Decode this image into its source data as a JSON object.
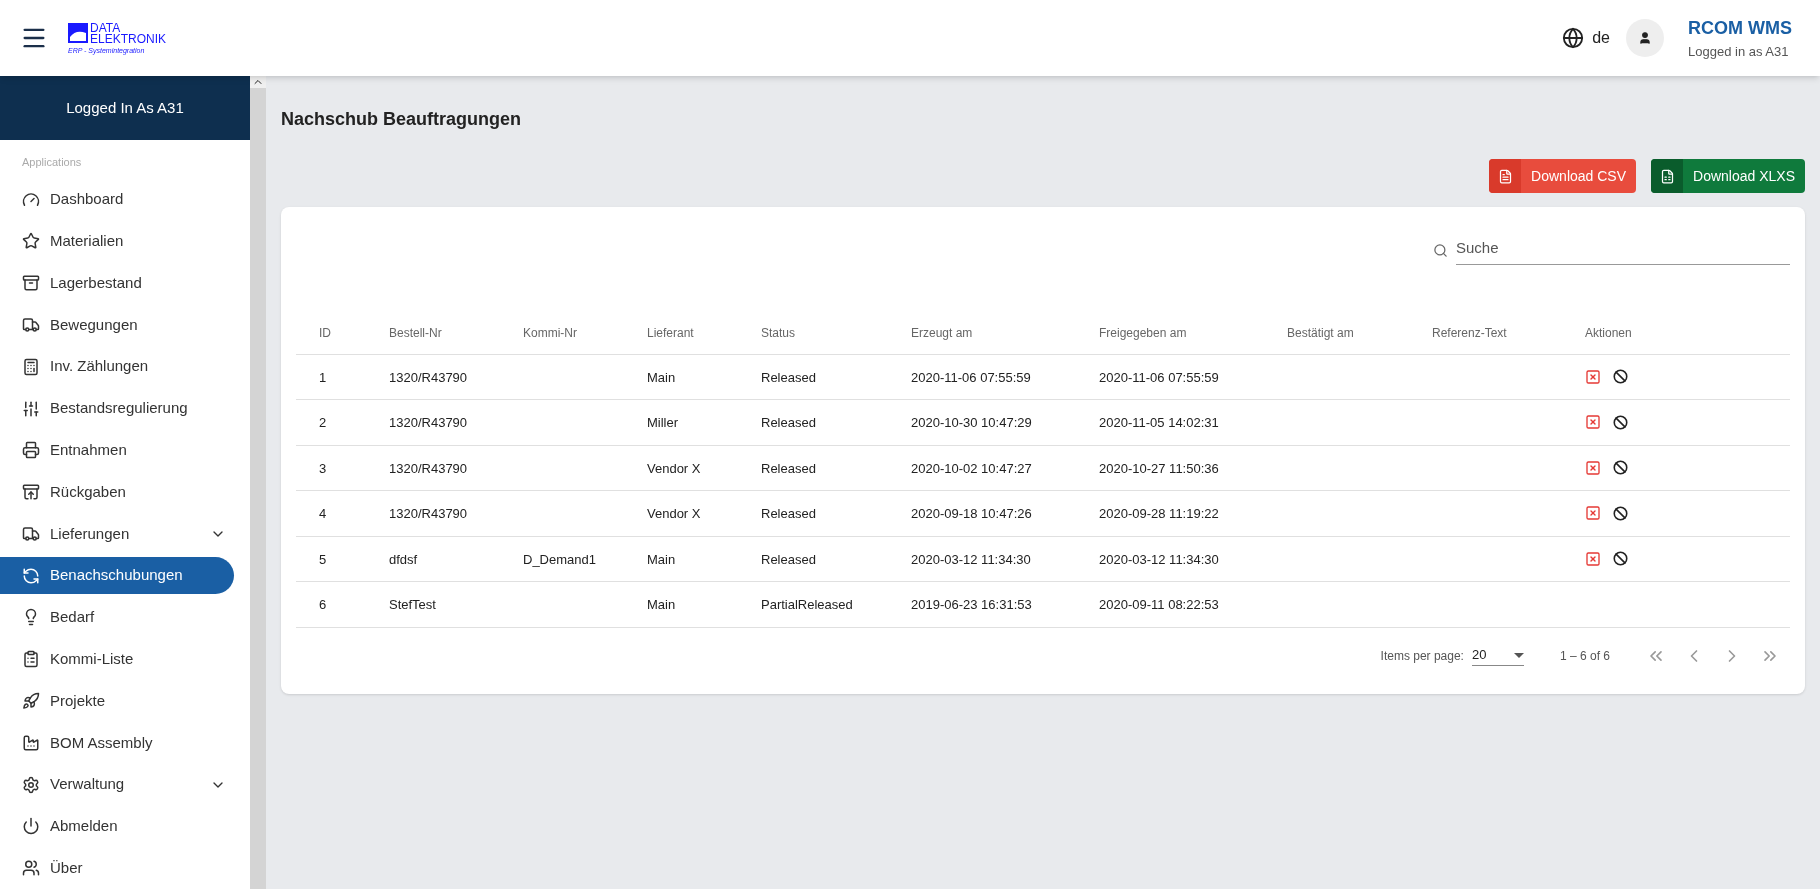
{
  "header": {
    "logo_line1": "DATA",
    "logo_line2": "ELEKTRONIK",
    "logo_tagline": "ERP - Systemintegration",
    "language": "de",
    "app_name": "RCOM WMS",
    "user_status": "Logged in as A31"
  },
  "sidebar": {
    "user_banner": "Logged In As A31",
    "section_label": "Applications",
    "items": [
      {
        "label": "Dashboard",
        "selected": false,
        "expandable": false
      },
      {
        "label": "Materialien",
        "selected": false,
        "expandable": false
      },
      {
        "label": "Lagerbestand",
        "selected": false,
        "expandable": false
      },
      {
        "label": "Bewegungen",
        "selected": false,
        "expandable": false
      },
      {
        "label": "Inv. Zählungen",
        "selected": false,
        "expandable": false
      },
      {
        "label": "Bestandsregulierung",
        "selected": false,
        "expandable": false
      },
      {
        "label": "Entnahmen",
        "selected": false,
        "expandable": false
      },
      {
        "label": "Rückgaben",
        "selected": false,
        "expandable": false
      },
      {
        "label": "Lieferungen",
        "selected": false,
        "expandable": true
      },
      {
        "label": "Benachschubungen",
        "selected": true,
        "expandable": false
      },
      {
        "label": "Bedarf",
        "selected": false,
        "expandable": false
      },
      {
        "label": "Kommi-Liste",
        "selected": false,
        "expandable": false
      },
      {
        "label": "Projekte",
        "selected": false,
        "expandable": false
      },
      {
        "label": "BOM Assembly",
        "selected": false,
        "expandable": false
      },
      {
        "label": "Verwaltung",
        "selected": false,
        "expandable": true
      },
      {
        "label": "Abmelden",
        "selected": false,
        "expandable": false
      },
      {
        "label": "Über",
        "selected": false,
        "expandable": false
      }
    ]
  },
  "page": {
    "title": "Nachschub Beauftragungen",
    "buttons": [
      {
        "kind": "csv",
        "label": "Download CSV"
      },
      {
        "kind": "xlsx",
        "label": "Download XLXS"
      }
    ],
    "search": {
      "placeholder": "Suche"
    },
    "table": {
      "columns": [
        "ID",
        "Bestell-Nr",
        "Kommi-Nr",
        "Lieferant",
        "Status",
        "Erzeugt am",
        "Freigegeben am",
        "Bestätigt am",
        "Referenz-Text",
        "Aktionen"
      ],
      "rows": [
        {
          "cells": [
            "1",
            "1320/R43790",
            "",
            "Main",
            "Released",
            "2020-11-06 07:55:59",
            "2020-11-06 07:55:59",
            "",
            ""
          ],
          "actions": true
        },
        {
          "cells": [
            "2",
            "1320/R43790",
            "",
            "Miller",
            "Released",
            "2020-10-30 10:47:29",
            "2020-11-05 14:02:31",
            "",
            ""
          ],
          "actions": true
        },
        {
          "cells": [
            "3",
            "1320/R43790",
            "",
            "Vendor X",
            "Released",
            "2020-10-02 10:47:27",
            "2020-10-27 11:50:36",
            "",
            ""
          ],
          "actions": true
        },
        {
          "cells": [
            "4",
            "1320/R43790",
            "",
            "Vendor X",
            "Released",
            "2020-09-18 10:47:26",
            "2020-09-28 11:19:22",
            "",
            ""
          ],
          "actions": true
        },
        {
          "cells": [
            "5",
            "dfdsf",
            "D_Demand1",
            "Main",
            "Released",
            "2020-03-12 11:34:30",
            "2020-03-12 11:34:30",
            "",
            ""
          ],
          "actions": true
        },
        {
          "cells": [
            "6",
            "StefTest",
            "",
            "Main",
            "PartialReleased",
            "2019-06-23 16:31:53",
            "2020-09-11 08:22:53",
            "",
            ""
          ],
          "actions": false
        }
      ]
    },
    "paginator": {
      "label": "Items per page:",
      "page_size": "20",
      "range": "1 – 6 of 6"
    }
  }
}
